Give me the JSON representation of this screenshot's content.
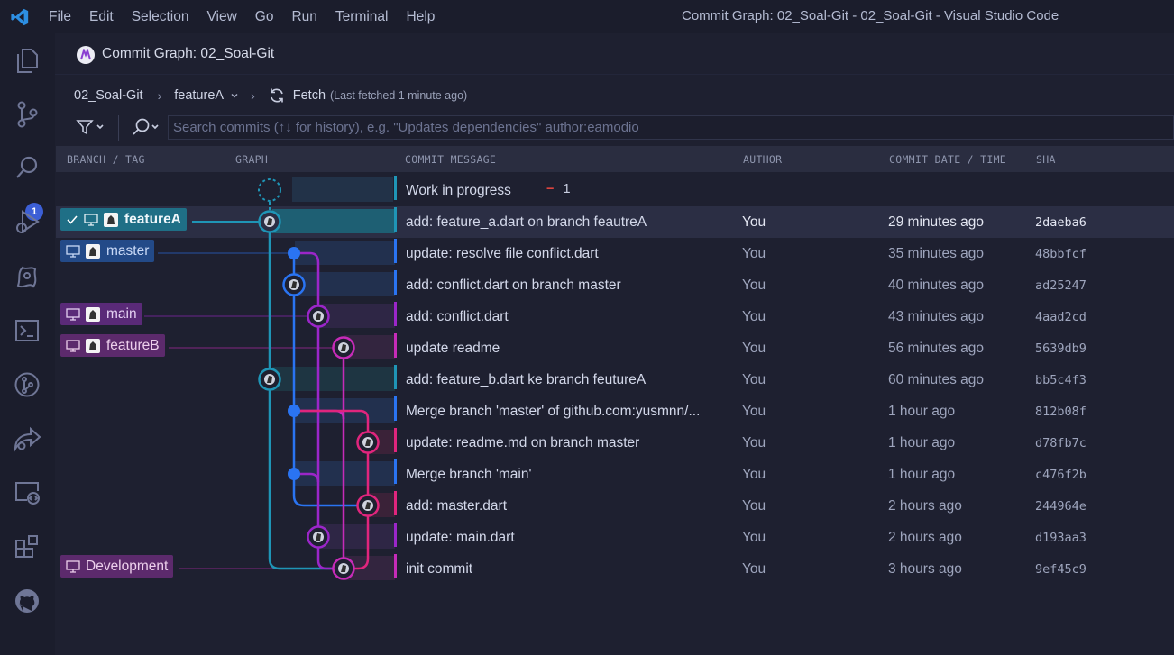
{
  "app": {
    "menu": [
      "File",
      "Edit",
      "Selection",
      "View",
      "Go",
      "Run",
      "Terminal",
      "Help"
    ],
    "window_title": "Commit Graph: 02_Soal-Git - 02_Soal-Git - Visual Studio Code"
  },
  "activity_bar": {
    "icons": [
      "explorer-icon",
      "source-control-icon",
      "search-icon",
      "run-debug-icon",
      "gitlens-icon",
      "terminal-icon",
      "git-graph-icon",
      "live-share-icon",
      "remote-explorer-icon",
      "extensions-icon",
      "github-icon"
    ],
    "search_badge": "1"
  },
  "tab": {
    "title": "Commit Graph: 02_Soal-Git"
  },
  "breadcrumb": {
    "repo": "02_Soal-Git",
    "branch": "featureA",
    "fetch_label": "Fetch",
    "fetch_note": "(Last fetched 1 minute ago)"
  },
  "search": {
    "placeholder": "Search commits (↑↓ for history), e.g. \"Updates dependencies\" author:eamodio"
  },
  "columns": {
    "branch": "BRANCH / TAG",
    "graph": "GRAPH",
    "message": "COMMIT MESSAGE",
    "author": "AUTHOR",
    "date": "COMMIT DATE / TIME",
    "sha": "SHA"
  },
  "wip": {
    "message": "Work in progress",
    "minus": "−",
    "count": "1"
  },
  "rows": [
    {
      "message": "add: feature_a.dart on branch feautreA",
      "author": "You",
      "date": "29 minutes ago",
      "sha": "2daeba6",
      "branch": "featureA"
    },
    {
      "message": "update: resolve file conflict.dart",
      "author": "You",
      "date": "35 minutes ago",
      "sha": "48bbfcf",
      "branch": "master"
    },
    {
      "message": "add: conflict.dart on branch master",
      "author": "You",
      "date": "40 minutes ago",
      "sha": "ad25247",
      "branch": ""
    },
    {
      "message": "add: conflict.dart",
      "author": "You",
      "date": "43 minutes ago",
      "sha": "4aad2cd",
      "branch": "main"
    },
    {
      "message": "update readme",
      "author": "You",
      "date": "56 minutes ago",
      "sha": "5639db9",
      "branch": "featureB"
    },
    {
      "message": "add: feature_b.dart ke branch feutureA",
      "author": "You",
      "date": "60 minutes ago",
      "sha": "bb5c4f3",
      "branch": ""
    },
    {
      "message": "Merge branch 'master' of github.com:yusmnn/...",
      "author": "You",
      "date": "1 hour ago",
      "sha": "812b08f",
      "branch": ""
    },
    {
      "message": "update: readme.md on branch master",
      "author": "You",
      "date": "1 hour ago",
      "sha": "d78fb7c",
      "branch": ""
    },
    {
      "message": "Merge branch 'main'",
      "author": "You",
      "date": "1 hour ago",
      "sha": "c476f2b",
      "branch": ""
    },
    {
      "message": "add: master.dart",
      "author": "You",
      "date": "2 hours ago",
      "sha": "244964e",
      "branch": ""
    },
    {
      "message": "update: main.dart",
      "author": "You",
      "date": "2 hours ago",
      "sha": "d193aa3",
      "branch": ""
    },
    {
      "message": "init commit",
      "author": "You",
      "date": "3 hours ago",
      "sha": "9ef45c9",
      "branch": "Development"
    }
  ],
  "colors": {
    "featureA": "#1f95b6",
    "master": "#2a74f2",
    "main": "#9b26c9",
    "featureB": "#c62bb8",
    "pink": "#e0257d"
  }
}
